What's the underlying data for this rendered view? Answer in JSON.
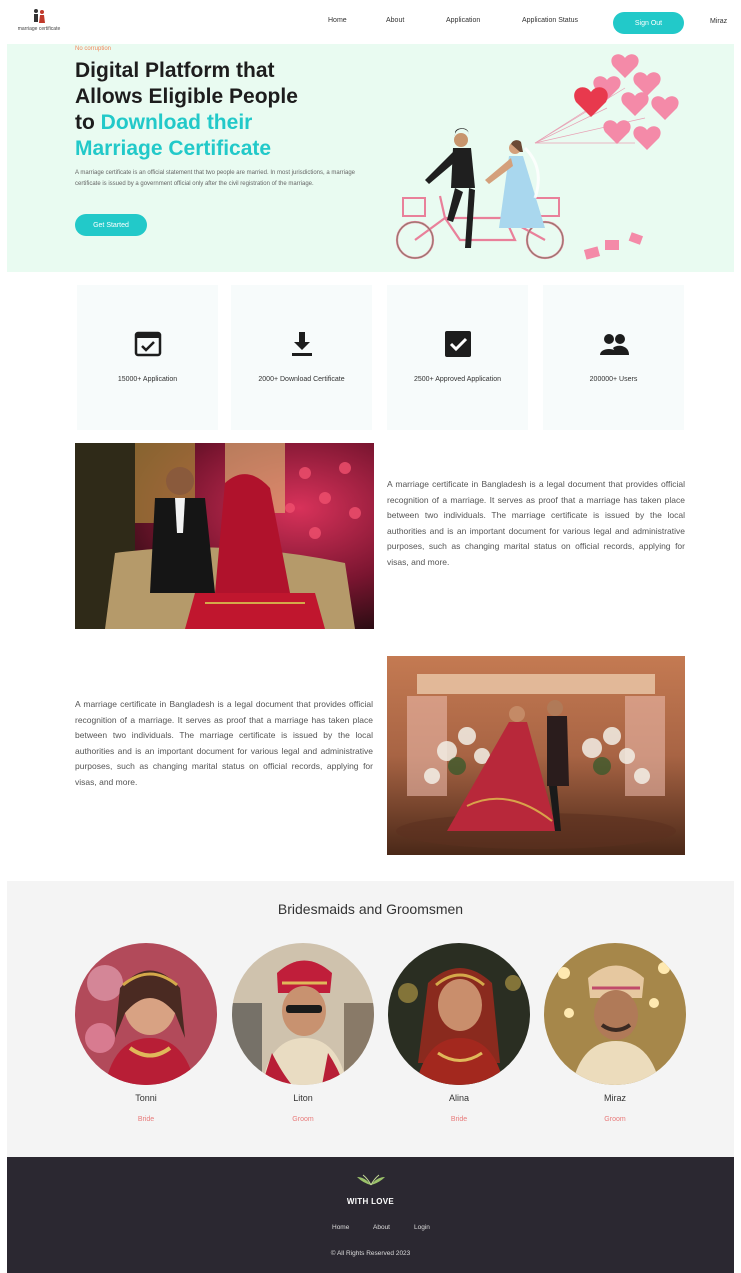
{
  "brand": {
    "logo_text": "marriage certificate"
  },
  "nav": {
    "links": [
      "Home",
      "About",
      "Application",
      "Application Status"
    ],
    "signout_label": "Sign Out",
    "user_name": "Miraz"
  },
  "hero": {
    "eyebrow": "No corruption",
    "title_line1": "Digital Platform that",
    "title_line2": "Allows Eligible People",
    "title_to": "to ",
    "title_hl1": "Download their",
    "title_hl2": "Marriage Certificate",
    "description": "A marriage certificate is an official statement that two people are married. In most jurisdictions, a marriage certificate is issued by a government official only after the civil registration of the marriage.",
    "cta_label": "Get Started"
  },
  "stats": [
    {
      "icon": "application-icon",
      "label": "15000+ Application"
    },
    {
      "icon": "download-icon",
      "label": "2000+ Download Certificate"
    },
    {
      "icon": "approved-icon",
      "label": "2500+ Approved Application"
    },
    {
      "icon": "users-icon",
      "label": "200000+ Users"
    }
  ],
  "about": {
    "paragraph1": "A marriage certificate in Bangladesh is a legal document that provides official recognition of a marriage. It serves as proof that a marriage has taken place between two individuals. The marriage certificate is issued by the local authorities and is an important document for various legal and administrative purposes, such as changing marital status on official records, applying for visas, and more.",
    "paragraph2": "A marriage certificate in Bangladesh is a legal document that provides official recognition of a marriage. It serves as proof that a marriage has taken place between two individuals. The marriage certificate is issued by the local authorities and is an important document for various legal and administrative purposes, such as changing marital status on official records, applying for visas, and more."
  },
  "team": {
    "title": "Bridesmaids and Groomsmen",
    "members": [
      {
        "name": "Tonni",
        "role": "Bride"
      },
      {
        "name": "Liton",
        "role": "Groom"
      },
      {
        "name": "Alina",
        "role": "Bride"
      },
      {
        "name": "Miraz",
        "role": "Groom"
      }
    ]
  },
  "footer": {
    "brand": "WITH LOVE",
    "links": [
      "Home",
      "About",
      "Login"
    ],
    "copyright": "© All Rights Reserved 2023"
  },
  "colors": {
    "accent": "#22c9c9",
    "hero_bg": "#e9fbf1",
    "footer_bg": "#2b2831",
    "role": "#e87b7b",
    "eyebrow": "#f08a5d"
  }
}
